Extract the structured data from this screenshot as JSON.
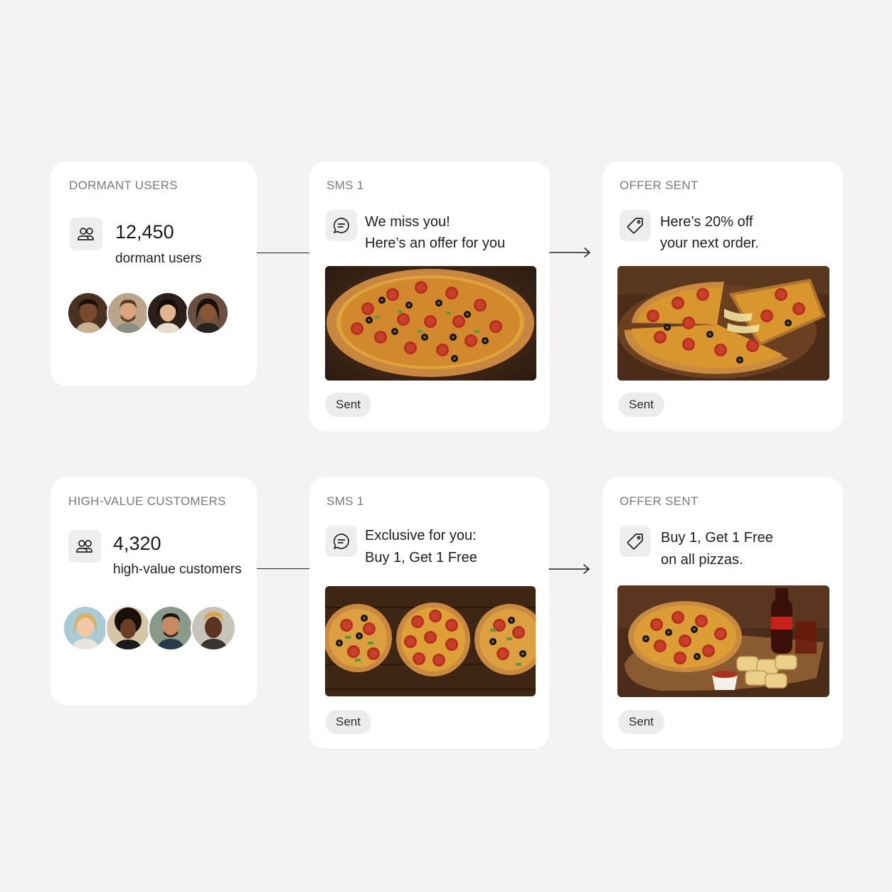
{
  "colors": {
    "background": "#f4f3f1",
    "card": "#ffffff",
    "label": "#7a7a7a",
    "pill": "#ececea"
  },
  "rows": [
    {
      "segment": {
        "label": "DORMANT USERS",
        "icon": "users-icon",
        "count": "12,450",
        "caption": "dormant users",
        "avatar_count": 4
      },
      "sms": {
        "label": "SMS 1",
        "icon": "chat-bubble-icon",
        "line1": "We miss you!",
        "line2": "Here’s an offer for you",
        "image": "pepperoni-pizza-photo",
        "status": "Sent"
      },
      "offer": {
        "label": "OFFER SENT",
        "icon": "price-tag-icon",
        "line1": "Here’s 20% off",
        "line2": "your next order.",
        "image": "pizza-slice-cheese-pull-photo",
        "status": "Sent"
      }
    },
    {
      "segment": {
        "label": "HIGH-VALUE CUSTOMERS",
        "icon": "users-icon",
        "count": "4,320",
        "caption": "high-value customers",
        "avatar_count": 4
      },
      "sms": {
        "label": "SMS 1",
        "icon": "chat-bubble-icon",
        "line1": "Exclusive for you:",
        "line2": "Buy 1, Get 1 Free",
        "image": "three-pizzas-photo",
        "status": "Sent"
      },
      "offer": {
        "label": "OFFER SENT",
        "icon": "price-tag-icon",
        "line1": "Buy 1, Get 1 Free",
        "line2": "on all pizzas.",
        "image": "pizza-bread-cola-photo",
        "status": "Sent"
      }
    }
  ]
}
